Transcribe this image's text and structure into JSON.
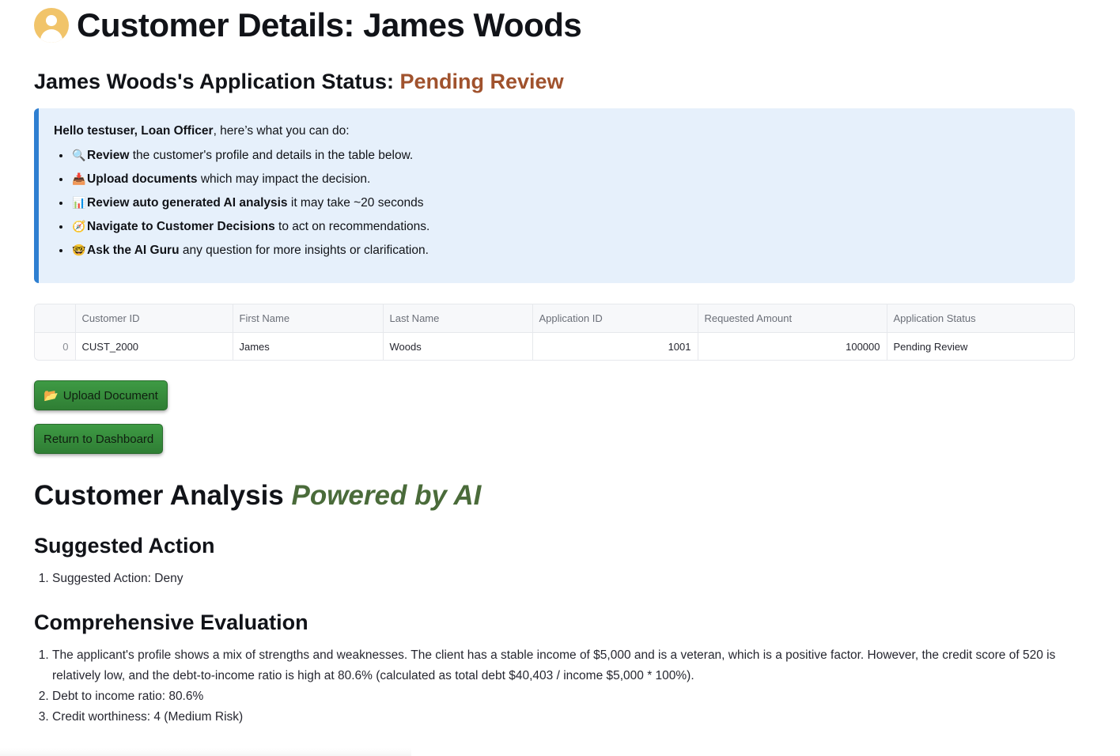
{
  "header": {
    "avatar_icon": "user-avatar-icon",
    "title": "Customer Details: James Woods"
  },
  "status": {
    "label": "James Woods's Application Status: ",
    "value": "Pending Review",
    "value_color": "#a0522d"
  },
  "info": {
    "greeting_bold": "Hello testuser, Loan Officer",
    "greeting_rest": ", here’s what you can do:",
    "items": [
      {
        "icon": "magnifier-icon",
        "glyph": "🔍",
        "bold": "Review",
        "rest": " the customer's profile and details in the table below."
      },
      {
        "icon": "inbox-tray-icon",
        "glyph": "📥",
        "bold": "Upload documents",
        "rest": " which may impact the decision."
      },
      {
        "icon": "bar-chart-icon",
        "glyph": "📊",
        "bold": "Review auto generated AI analysis",
        "rest": " it may take ~20 seconds"
      },
      {
        "icon": "compass-icon",
        "glyph": "🧭",
        "bold": "Navigate to Customer Decisions",
        "rest": " to act on recommendations."
      },
      {
        "icon": "nerd-face-icon",
        "glyph": "🤓",
        "bold": "Ask the AI Guru",
        "rest": " any question for more insights or clarification."
      }
    ]
  },
  "table": {
    "columns": [
      "",
      "Customer ID",
      "First Name",
      "Last Name",
      "Application ID",
      "Requested Amount",
      "Application Status"
    ],
    "rows": [
      {
        "index": "0",
        "customer_id": "CUST_2000",
        "first_name": "James",
        "last_name": "Woods",
        "application_id": "1001",
        "requested_amount": "100000",
        "application_status": "Pending Review"
      }
    ]
  },
  "buttons": {
    "upload_icon": "folder-icon",
    "upload_glyph": "📂",
    "upload_label": "Upload Document",
    "return_label": "Return to Dashboard",
    "color": "#3a9140"
  },
  "analysis": {
    "title": "Customer Analysis ",
    "powered": "Powered by AI",
    "suggested_heading": "Suggested Action",
    "suggested_items": [
      "Suggested Action: Deny"
    ],
    "evaluation_heading": "Comprehensive Evaluation",
    "evaluation_items": [
      "The applicant's profile shows a mix of strengths and weaknesses. The client has a stable income of $5,000 and is a veteran, which is a positive factor. However, the credit score of 520 is relatively low, and the debt-to-income ratio is high at 80.6% (calculated as total debt $40,403 / income $5,000 * 100%).",
      "Debt to income ratio: 80.6%",
      "Credit worthiness: 4 (Medium Risk)"
    ]
  }
}
